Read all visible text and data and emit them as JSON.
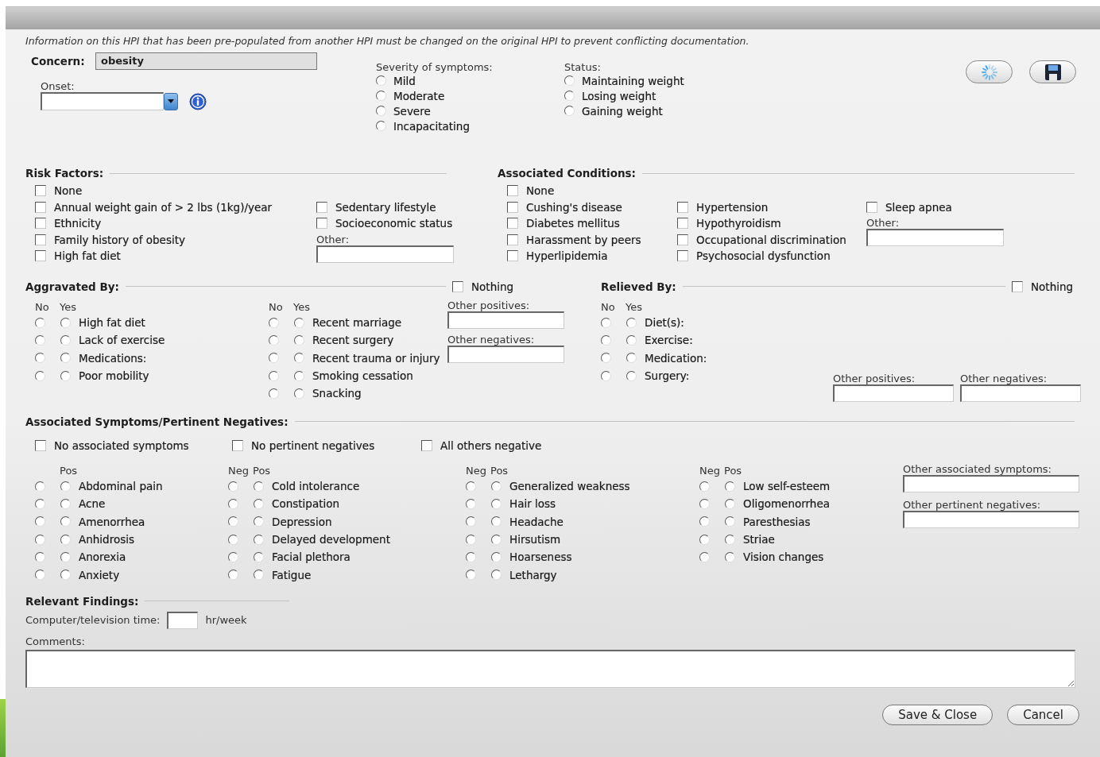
{
  "notice": "Information on this HPI that has been pre-populated from another HPI must be changed on the original HPI to prevent conflicting documentation.",
  "concern": {
    "label": "Concern:",
    "value": "obesity"
  },
  "onset": {
    "label": "Onset:"
  },
  "severity": {
    "label": "Severity of symptoms:",
    "options": [
      {
        "label": "Mild",
        "selected": false
      },
      {
        "label": "Moderate",
        "selected": false
      },
      {
        "label": "Severe",
        "selected": false
      },
      {
        "label": "Incapacitating",
        "selected": false
      }
    ]
  },
  "status": {
    "label": "Status:",
    "options": [
      {
        "label": "Maintaining weight",
        "selected": false
      },
      {
        "label": "Losing weight",
        "selected": false
      },
      {
        "label": "Gaining weight",
        "selected": false
      }
    ]
  },
  "toolbar": [
    {
      "kind": "spinner"
    },
    {
      "kind": "save"
    }
  ],
  "risk_factors": {
    "title": "Risk Factors:",
    "columns": [
      {
        "items": [
          {
            "label": "None",
            "checked": false
          },
          {
            "label": "Annual weight gain of > 2 lbs (1kg)/year",
            "checked": false
          },
          {
            "label": "Ethnicity",
            "checked": false
          },
          {
            "label": "Family history of obesity",
            "checked": false
          },
          {
            "label": "High fat diet",
            "checked": false
          }
        ]
      },
      {
        "items": [
          {
            "label": "Sedentary lifestyle",
            "checked": false
          },
          {
            "label": "Socioeconomic status",
            "checked": false
          }
        ],
        "other_label": "Other:"
      }
    ]
  },
  "associated_conditions": {
    "title": "Associated Conditions:",
    "columns": [
      {
        "items": [
          {
            "label": "None",
            "checked": false
          },
          {
            "label": "Cushing's disease",
            "checked": false
          },
          {
            "label": "Diabetes mellitus",
            "checked": false
          },
          {
            "label": "Harassment by peers",
            "checked": false
          },
          {
            "label": "Hyperlipidemia",
            "checked": false
          }
        ]
      },
      {
        "items": [
          {
            "label": "Hypertension",
            "checked": false
          },
          {
            "label": "Hypothyroidism",
            "checked": false
          },
          {
            "label": "Occupational discrimination",
            "checked": false
          },
          {
            "label": "Psychosocial dysfunction",
            "checked": false
          }
        ]
      },
      {
        "items": [
          {
            "label": "Sleep apnea",
            "checked": false
          }
        ],
        "other_label": "Other:"
      }
    ]
  },
  "aggravated_by": {
    "title": "Aggravated By:",
    "nothing": {
      "label": "Nothing",
      "checked": false
    },
    "groups": [
      {
        "no_label": "No",
        "yes_label": "Yes",
        "items": [
          {
            "label": "High fat diet",
            "no": false,
            "yes": false
          },
          {
            "label": "Lack of exercise",
            "no": false,
            "yes": false
          },
          {
            "label": "Medications:",
            "no": false,
            "yes": false
          },
          {
            "label": "Poor mobility",
            "no": false,
            "yes": false
          }
        ]
      },
      {
        "no_label": "No",
        "yes_label": "Yes",
        "items": [
          {
            "label": "Recent marriage",
            "no": false,
            "yes": false
          },
          {
            "label": "Recent surgery",
            "no": false,
            "yes": false
          },
          {
            "label": "Recent trauma or injury",
            "no": false,
            "yes": false
          },
          {
            "label": "Smoking cessation",
            "no": false,
            "yes": false
          },
          {
            "label": "Snacking",
            "no": false,
            "yes": false
          }
        ]
      }
    ],
    "other_positives": "Other positives:",
    "other_negatives": "Other negatives:"
  },
  "relieved_by": {
    "title": "Relieved By:",
    "nothing": {
      "label": "Nothing",
      "checked": false
    },
    "group": {
      "no_label": "No",
      "yes_label": "Yes",
      "items": [
        {
          "label": "Diet(s):",
          "no": false,
          "yes": false
        },
        {
          "label": "Exercise:",
          "no": false,
          "yes": false
        },
        {
          "label": "Medication:",
          "no": false,
          "yes": false
        },
        {
          "label": "Surgery:",
          "no": false,
          "yes": false
        }
      ]
    },
    "other_positives": "Other positives:",
    "other_negatives": "Other negatives:"
  },
  "associated_symptoms": {
    "title": "Associated Symptoms/Pertinent Negatives:",
    "checks": [
      {
        "label": "No associated symptoms",
        "checked": false
      },
      {
        "label": "No pertinent negatives",
        "checked": false
      },
      {
        "label": "All others negative",
        "checked": false
      }
    ],
    "groups": [
      {
        "pos_label": "Pos",
        "items": [
          {
            "label": "Abdominal pain",
            "neg": false,
            "pos": false
          },
          {
            "label": "Acne",
            "neg": false,
            "pos": false
          },
          {
            "label": "Amenorrhea",
            "neg": false,
            "pos": false
          },
          {
            "label": "Anhidrosis",
            "neg": false,
            "pos": false
          },
          {
            "label": "Anorexia",
            "neg": false,
            "pos": false
          },
          {
            "label": "Anxiety",
            "neg": false,
            "pos": false
          }
        ]
      },
      {
        "neg_label": "Neg",
        "pos_label": "Pos",
        "items": [
          {
            "label": "Cold intolerance",
            "neg": false,
            "pos": false
          },
          {
            "label": "Constipation",
            "neg": false,
            "pos": false
          },
          {
            "label": "Depression",
            "neg": false,
            "pos": false
          },
          {
            "label": "Delayed development",
            "neg": false,
            "pos": false
          },
          {
            "label": "Facial plethora",
            "neg": false,
            "pos": false
          },
          {
            "label": "Fatigue",
            "neg": false,
            "pos": false
          }
        ]
      },
      {
        "neg_label": "Neg",
        "pos_label": "Pos",
        "items": [
          {
            "label": "Generalized weakness",
            "neg": false,
            "pos": false
          },
          {
            "label": "Hair loss",
            "neg": false,
            "pos": false
          },
          {
            "label": "Headache",
            "neg": false,
            "pos": false
          },
          {
            "label": "Hirsutism",
            "neg": false,
            "pos": false
          },
          {
            "label": "Hoarseness",
            "neg": false,
            "pos": false
          },
          {
            "label": "Lethargy",
            "neg": false,
            "pos": false
          }
        ]
      },
      {
        "neg_label": "Neg",
        "pos_label": "Pos",
        "items": [
          {
            "label": "Low self-esteem",
            "neg": false,
            "pos": false
          },
          {
            "label": "Oligomenorrhea",
            "neg": false,
            "pos": false
          },
          {
            "label": "Paresthesias",
            "neg": false,
            "pos": false
          },
          {
            "label": "Striae",
            "neg": false,
            "pos": false
          },
          {
            "label": "Vision changes",
            "neg": false,
            "pos": false
          }
        ]
      }
    ],
    "other_associated": "Other associated symptoms:",
    "other_negatives": "Other pertinent negatives:"
  },
  "relevant_findings": {
    "title": "Relevant Findings:",
    "time_label": "Computer/television time:",
    "unit": "hr/week"
  },
  "comments": {
    "label": "Comments:"
  },
  "buttons": [
    {
      "label": "Save & Close"
    },
    {
      "label": "Cancel"
    }
  ]
}
